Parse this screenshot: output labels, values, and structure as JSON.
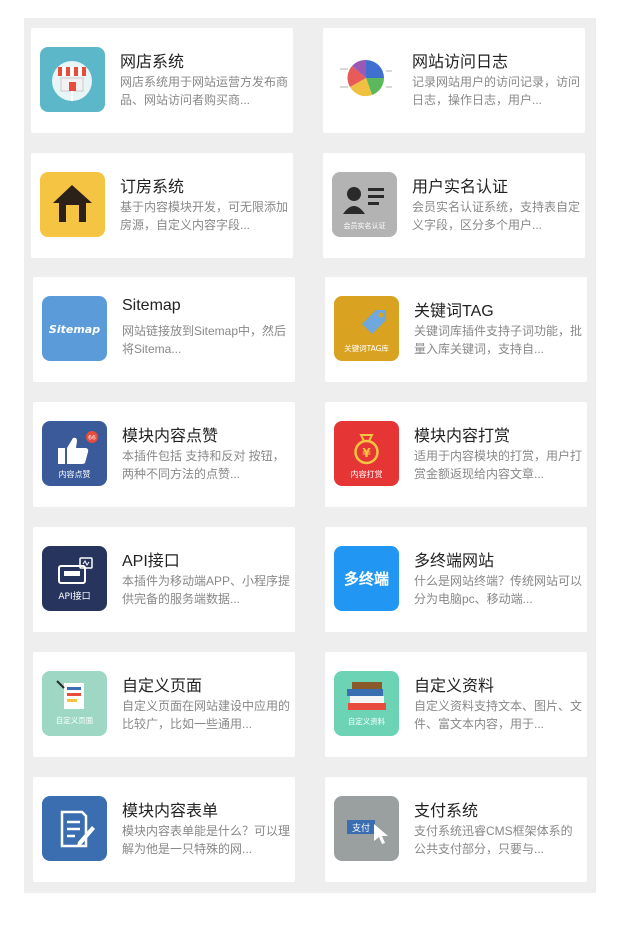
{
  "plugins": [
    {
      "title": "网店系统",
      "desc": "网店系统用于网站运营方发布商品、网站访问者购买商...",
      "icon": "storefront-icon",
      "color": "#5cb8c8"
    },
    {
      "title": "网站访问日志",
      "desc": "记录网站用户的访问记录，访问日志，操作日志，用户...",
      "icon": "pie-chart-icon",
      "color": "#ffffff"
    },
    {
      "title": "订房系统",
      "desc": "基于内容模块开发，可无限添加房源，自定义内容字段...",
      "icon": "house-icon",
      "color": "#f5c442"
    },
    {
      "title": "用户实名认证",
      "desc": "会员实名认证系统，支持表自定义字段，区分多个用户...",
      "icon": "id-card-icon",
      "color": "#b3b3b3",
      "icon_label": "会员实名认证"
    },
    {
      "title": "Sitemap",
      "desc": "网站链接放到Sitemap中，然后将Sitema...",
      "icon": "sitemap-icon",
      "color": "#5b9bd9",
      "icon_label": "Sitemap"
    },
    {
      "title": "关键词TAG",
      "desc": "关键词库插件支持子词功能，批量入库关键词，支持自...",
      "icon": "tag-icon",
      "color": "#d9a321",
      "icon_label": "关键词TAG库"
    },
    {
      "title": "模块内容点赞",
      "desc": "本插件包括 支持和反对 按钮，两种不同方法的点赞...",
      "icon": "thumbs-up-icon",
      "color": "#3b5a9a",
      "icon_label": "内容点赞",
      "badge": "66"
    },
    {
      "title": "模块内容打赏",
      "desc": "适用于内容模块的打赏，用户打赏金额返现给内容文章...",
      "icon": "money-bag-icon",
      "color": "#e63535",
      "icon_label": "内容打赏"
    },
    {
      "title": "API接口",
      "desc": "本插件为移动端APP、小程序提供完备的服务端数据...",
      "icon": "api-icon",
      "color": "#26345e",
      "icon_label": "API接口"
    },
    {
      "title": "多终端网站",
      "desc": "什么是网站终端？传统网站可以分为电脑pc、移动端...",
      "icon": "multi-terminal-icon",
      "color": "#2196f3",
      "icon_label": "多终端"
    },
    {
      "title": "自定义页面",
      "desc": "自定义页面在网站建设中应用的比较广，比如一些通用...",
      "icon": "custom-page-icon",
      "color": "#9ed8c4",
      "icon_label": "自定义页面"
    },
    {
      "title": "自定义资料",
      "desc": "自定义资料支持文本、图片、文件、富文本内容，用于...",
      "icon": "books-icon",
      "color": "#6cd4b4",
      "icon_label": "自定义资料"
    },
    {
      "title": "模块内容表单",
      "desc": "模块内容表单能是什么？可以理解为他是一只特殊的网...",
      "icon": "form-icon",
      "color": "#3a6eb0"
    },
    {
      "title": "支付系统",
      "desc": "支付系统迅睿CMS框架体系的公共支付部分，只要与...",
      "icon": "payment-icon",
      "color": "#9aa0a0",
      "icon_label": "支付"
    }
  ]
}
